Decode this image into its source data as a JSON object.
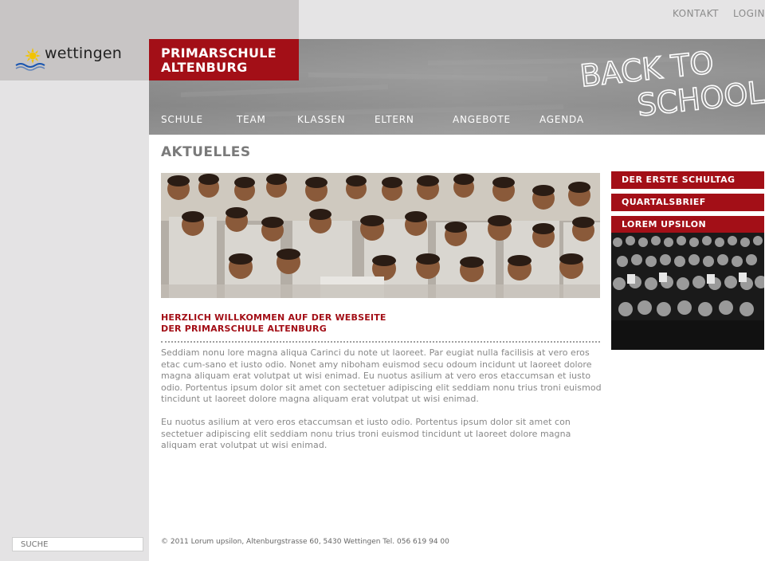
{
  "brand": {
    "logo_text": "wettingen",
    "school_name_line1": "PRIMARSCHULE",
    "school_name_line2": "ALTENBURG",
    "header_graphic_line1": "BACK TO",
    "header_graphic_line2": "SCHOOL"
  },
  "utility_nav": [
    {
      "label": "KONTAKT"
    },
    {
      "label": "LOGIN"
    }
  ],
  "main_nav": [
    {
      "label": "SCHULE"
    },
    {
      "label": "TEAM"
    },
    {
      "label": "KLASSEN"
    },
    {
      "label": "ELTERN"
    },
    {
      "label": "ANGEBOTE"
    },
    {
      "label": "AGENDA"
    }
  ],
  "main": {
    "title": "AKTUELLES",
    "welcome_line1": "HERZLICH WILLKOMMEN AUF DER WEBSEITE",
    "welcome_line2": "DER PRIMARSCHULE ALTENBURG",
    "paragraph1": "Seddiam nonu lore magna aliqua Carinci du note ut laoreet. Par eugiat nulla facilisis at vero eros etac cum-sano et iusto odio. Nonet amy niboham euismod secu odoum incidunt ut laoreet dolore magna aliquam erat volutpat ut wisi enimad. Eu nuotus asilium at vero eros etaccumsan et iusto odio. Portentus ipsum dolor sit amet con sectetuer adipiscing elit seddiam nonu trius troni euismod tincidunt ut laoreet dolore magna aliquam erat volutpat ut wisi enimad.",
    "paragraph2": "Eu nuotus asilium at vero eros etaccumsan et iusto odio. Portentus ipsum dolor sit amet con sectetuer adipiscing elit seddiam nonu trius troni euismod tincidunt ut laoreet dolore magna aliquam erat volutpat ut wisi enimad."
  },
  "sidebar": {
    "links": [
      {
        "label": "DER ERSTE SCHULTAG"
      },
      {
        "label": "QUARTALSBRIEF"
      },
      {
        "label": "LOREM UPSILON"
      }
    ]
  },
  "search": {
    "placeholder": "SUCHE"
  },
  "footer": {
    "text": "© 2011 Lorum upsilon, Altenburgstrasse 60, 5430 Wettingen Tel. 056 619 94 00"
  },
  "colors": {
    "accent": "#a30f17",
    "left_bg": "#e4e3e4",
    "chalkboard": "#8f8f8f"
  }
}
